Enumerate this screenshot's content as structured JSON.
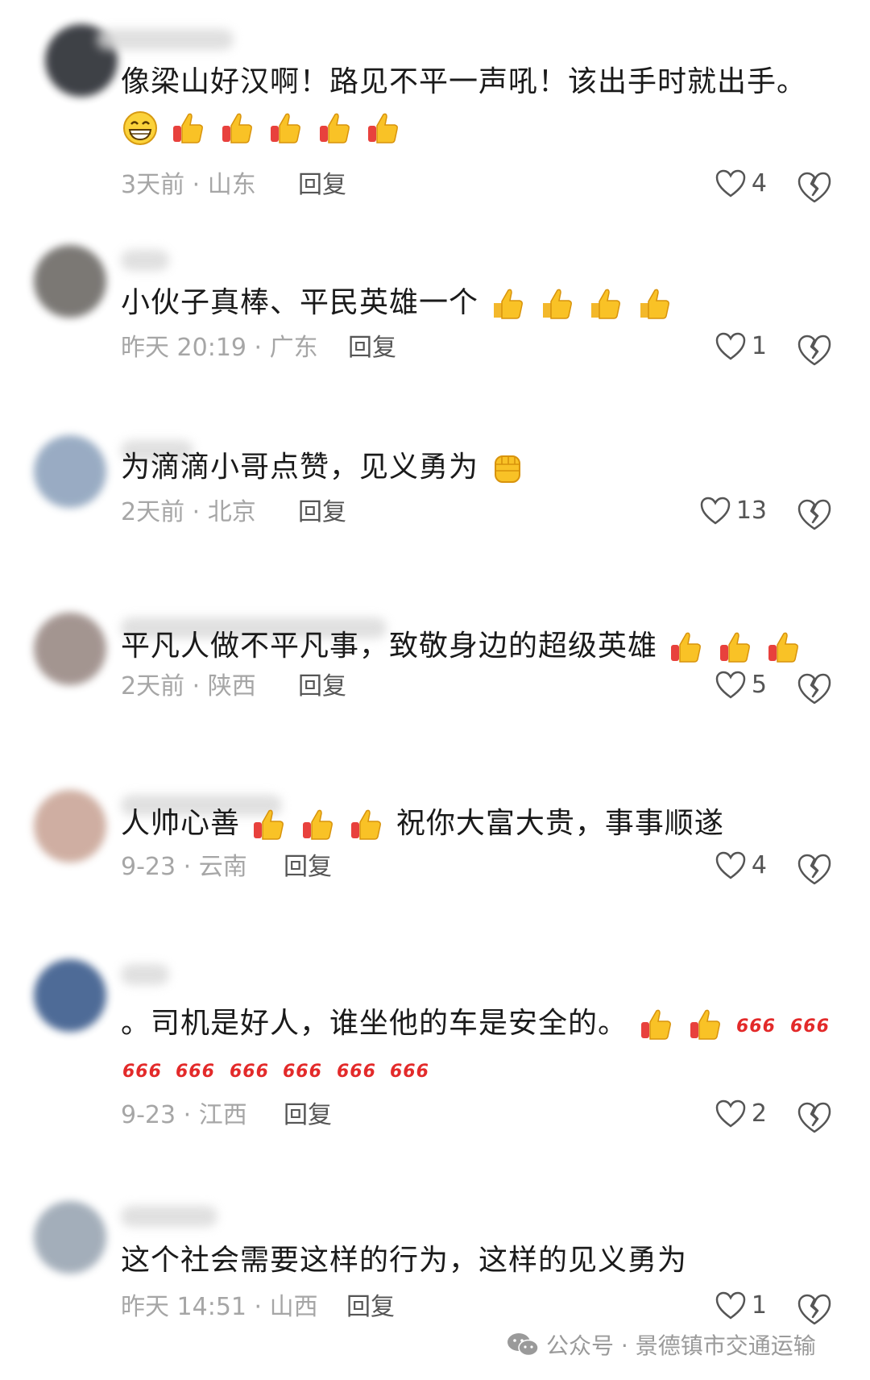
{
  "comments": [
    {
      "text": "像梁山好汉啊！路见不平一声吼！该出手时就出手。",
      "emoji_line": [
        "grin-emoji",
        "thumbs-up-emoji",
        "thumbs-up-emoji",
        "thumbs-up-emoji",
        "thumbs-up-emoji",
        "thumbs-up-emoji"
      ],
      "time_location": "3天前 · 山东",
      "reply": "回复",
      "likes": "4"
    },
    {
      "text": "小伙子真棒、平民英雄一个",
      "trailing_emojis": [
        "thumbs-up-emoji",
        "thumbs-up-emoji",
        "thumbs-up-emoji",
        "thumbs-up-emoji"
      ],
      "time_location": "昨天 20:19 · 广东",
      "reply": "回复",
      "likes": "1"
    },
    {
      "text": "为滴滴小哥点赞，见义勇为",
      "trailing_emojis": [
        "fist-emoji"
      ],
      "time_location": "2天前 · 北京",
      "reply": "回复",
      "likes": "13"
    },
    {
      "text": "平凡人做不平凡事，致敬身边的超级英雄",
      "trailing_emojis": [
        "thumbs-up-emoji",
        "thumbs-up-emoji",
        "thumbs-up-emoji"
      ],
      "time_location": "2天前 · 陕西",
      "reply": "回复",
      "likes": "5"
    },
    {
      "text_before": "人帅心善",
      "middle_emojis": [
        "thumbs-up-emoji",
        "thumbs-up-emoji",
        "thumbs-up-emoji"
      ],
      "text_after": "祝你大富大贵，事事顺遂",
      "time_location": "9-23 · 云南",
      "reply": "回复",
      "likes": "4"
    },
    {
      "text": "。司机是好人，谁坐他的车是安全的。",
      "trailing_emojis": [
        "thumbs-up-emoji",
        "thumbs-up-emoji",
        "666-emoji",
        "666-emoji"
      ],
      "emoji_line": [
        "666-emoji",
        "666-emoji",
        "666-emoji",
        "666-emoji",
        "666-emoji",
        "666-emoji"
      ],
      "time_location": "9-23 · 江西",
      "reply": "回复",
      "likes": "2"
    },
    {
      "text": "这个社会需要这样的行为，这样的见义勇为",
      "time_location": "昨天 14:51 · 山西",
      "reply": "回复",
      "likes": "1"
    }
  ],
  "watermark": {
    "text": "公众号 · 景德镇市交通运输"
  },
  "colors": {
    "meta_gray": "#a6a6a6",
    "text": "#1a1a1a",
    "thumb_yellow": "#f9c226",
    "thumb_red": "#e8413d",
    "red_666": "#e32a2a"
  }
}
